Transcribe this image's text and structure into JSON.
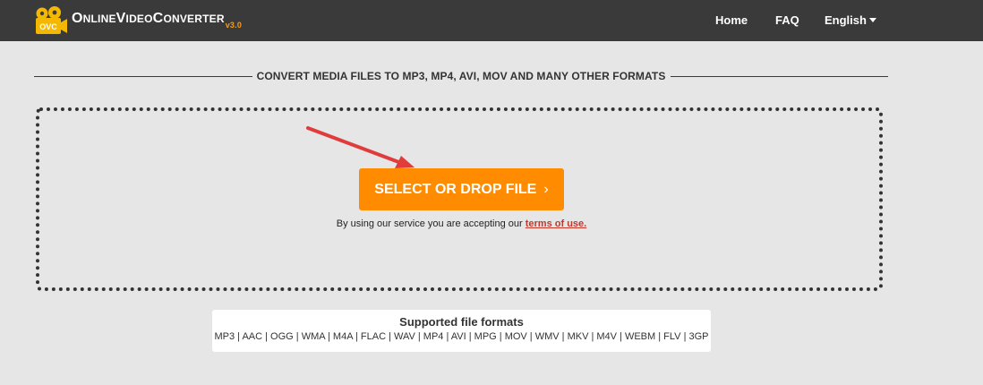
{
  "brand": {
    "logo_badge": "OVC",
    "name_first_letter": "O",
    "name_part1": "NLINE",
    "name_v": "V",
    "name_part2": "IDEO",
    "name_c": "C",
    "name_part3": "ONVERTER",
    "version": "v3.0"
  },
  "nav": {
    "home": "Home",
    "faq": "FAQ",
    "language": "English"
  },
  "main": {
    "heading": "CONVERT MEDIA FILES TO MP3, MP4, AVI, MOV AND MANY OTHER FORMATS",
    "select_button": "SELECT OR DROP FILE",
    "select_chevron": "›",
    "terms_prefix": "By using our service you are accepting our",
    "terms_link": "terms of use."
  },
  "formats": {
    "title": "Supported file formats",
    "list": "MP3 | AAC | OGG | WMA | M4A | FLAC | WAV | MP4 | AVI | MPG | MOV | WMV | MKV | M4V | WEBM | FLV | 3GP"
  },
  "colors": {
    "header_bg": "#3a3a3a",
    "accent_orange": "#ff8c00",
    "logo_yellow": "#f5b800",
    "link_red": "#c0392b",
    "arrow_red": "#e03c3c",
    "page_bg": "#e6e6e6"
  },
  "icons": {
    "logo": "video-camera-icon",
    "language_caret": "caret-down-icon",
    "button_chevron": "chevron-right-icon",
    "annotation_arrow": "red-arrow-icon"
  }
}
